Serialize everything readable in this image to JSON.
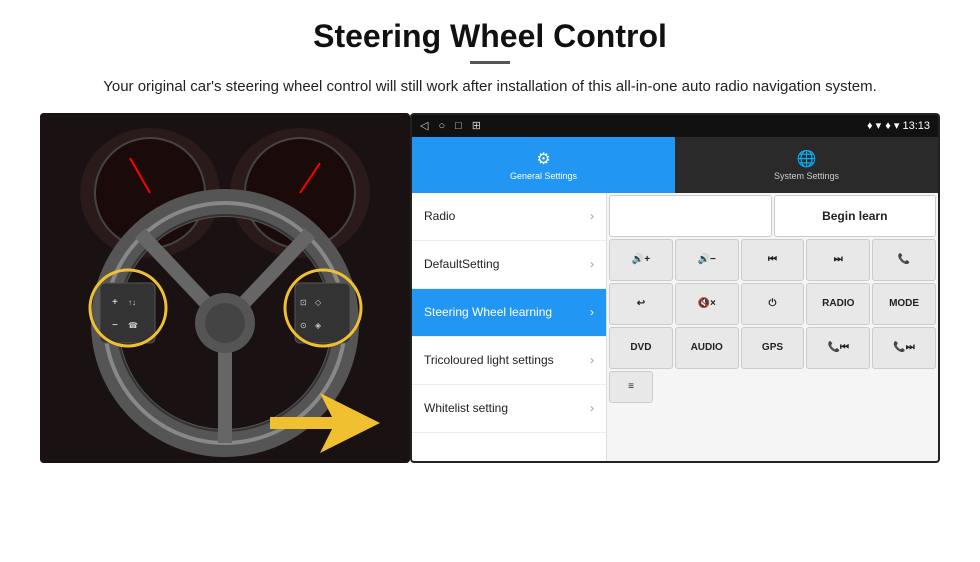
{
  "header": {
    "title": "Steering Wheel Control",
    "subtitle": "Your original car's steering wheel control will still work after installation of this all-in-one auto radio navigation system."
  },
  "status_bar": {
    "nav_icons": [
      "◁",
      "○",
      "□",
      "⊞"
    ],
    "right": "♦ ▾ 13:13"
  },
  "tabs": [
    {
      "label": "General Settings",
      "active": true
    },
    {
      "label": "System Settings",
      "active": false
    }
  ],
  "menu_items": [
    {
      "label": "Radio",
      "active": false
    },
    {
      "label": "DefaultSetting",
      "active": false
    },
    {
      "label": "Steering Wheel learning",
      "active": true
    },
    {
      "label": "Tricoloured light settings",
      "active": false
    },
    {
      "label": "Whitelist setting",
      "active": false
    }
  ],
  "controls": {
    "row0": [
      {
        "label": "",
        "type": "empty"
      },
      {
        "label": "Begin learn",
        "type": "begin-learn"
      }
    ],
    "row1": [
      {
        "label": "🔊+",
        "type": "icon"
      },
      {
        "label": "🔊−",
        "type": "icon"
      },
      {
        "label": "⏮",
        "type": "icon"
      },
      {
        "label": "⏭",
        "type": "icon"
      },
      {
        "label": "📞",
        "type": "icon"
      }
    ],
    "row2": [
      {
        "label": "↩",
        "type": "icon"
      },
      {
        "label": "🔇×",
        "type": "icon"
      },
      {
        "label": "⏻",
        "type": "icon"
      },
      {
        "label": "RADIO",
        "type": "text"
      },
      {
        "label": "MODE",
        "type": "text"
      }
    ],
    "row3": [
      {
        "label": "DVD",
        "type": "text"
      },
      {
        "label": "AUDIO",
        "type": "text"
      },
      {
        "label": "GPS",
        "type": "text"
      },
      {
        "label": "📞⏮",
        "type": "icon"
      },
      {
        "label": "📞⏭",
        "type": "icon"
      }
    ],
    "row4": [
      {
        "label": "≡",
        "type": "icon"
      }
    ]
  }
}
